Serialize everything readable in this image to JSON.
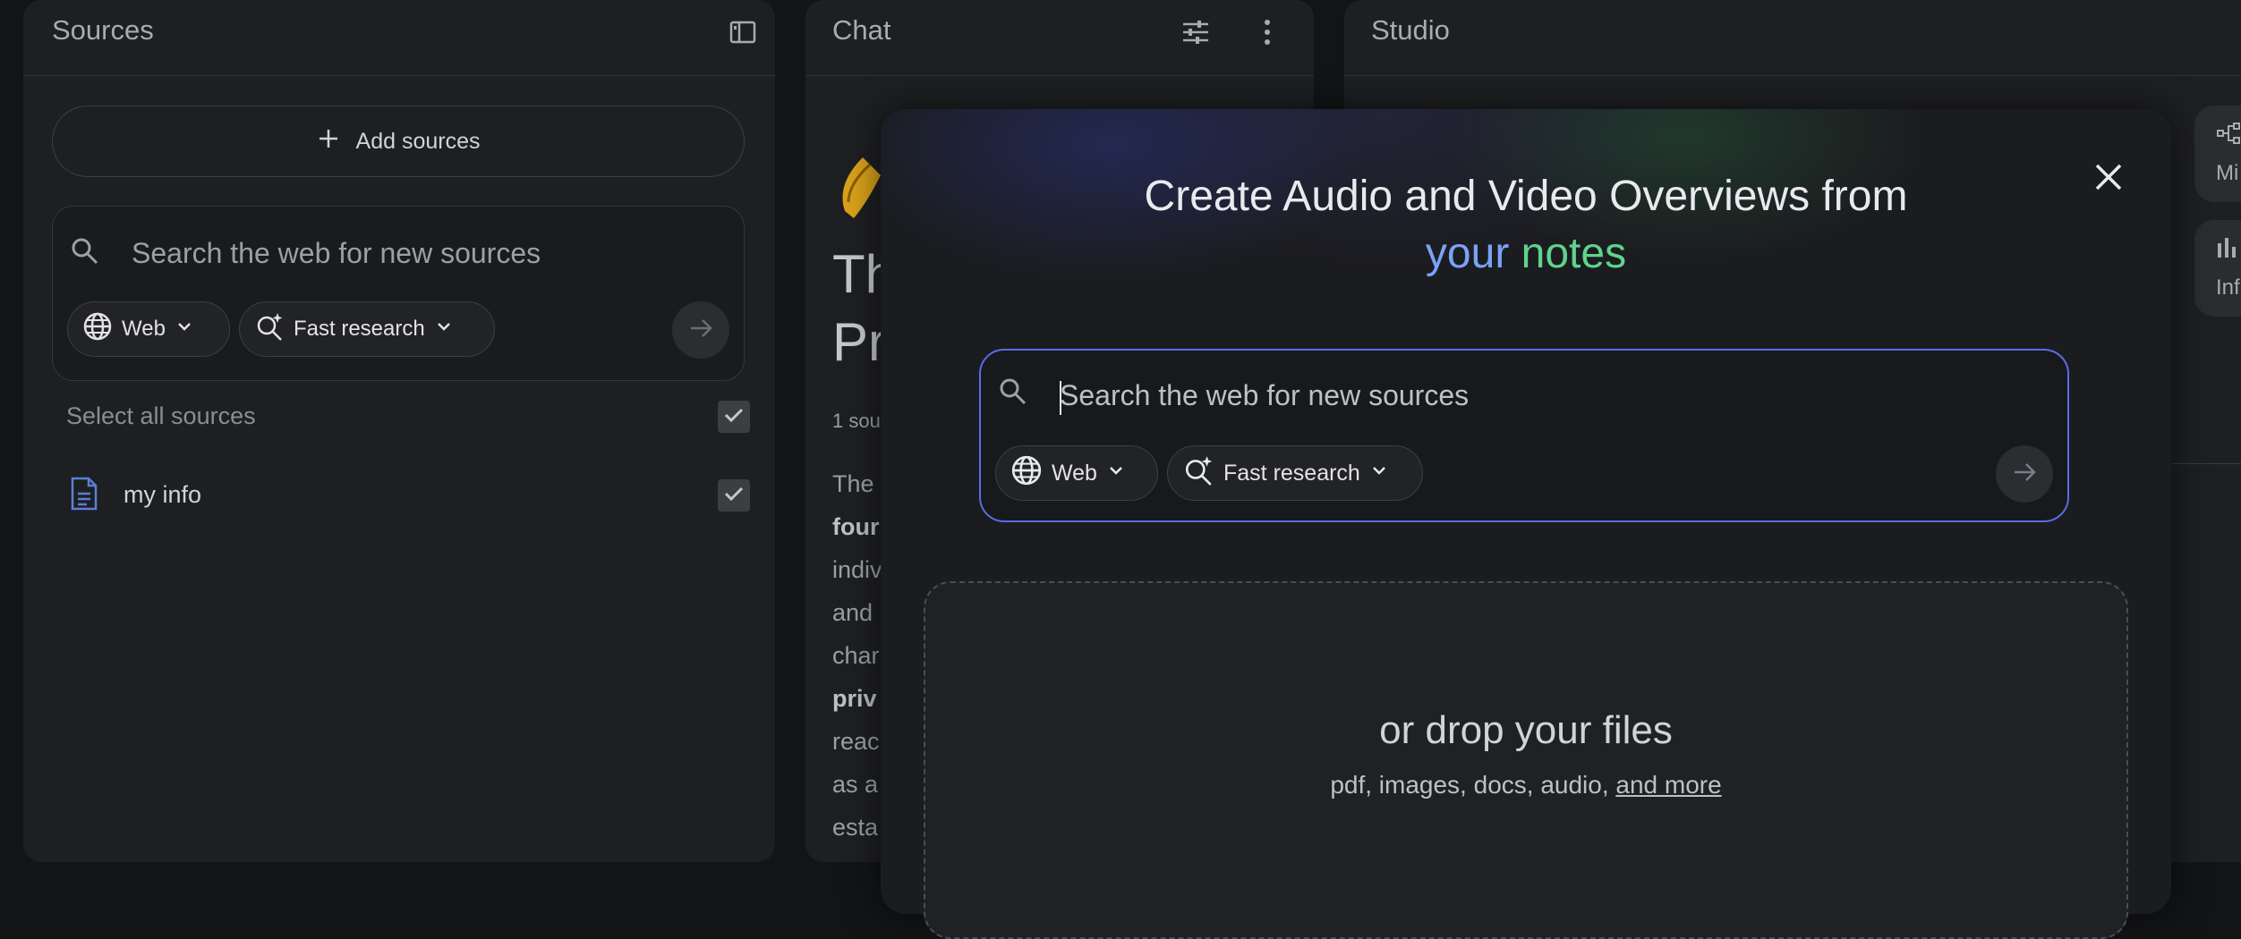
{
  "sources": {
    "title": "Sources",
    "add_sources_label": "Add sources",
    "search_placeholder": "Search the web for new sources",
    "web_chip": "Web",
    "research_chip": "Fast research",
    "select_all_label": "Select all sources",
    "items": [
      {
        "label": "my info",
        "checked": true
      }
    ]
  },
  "chat": {
    "title": "Chat",
    "heading_fragment_1": "Th",
    "heading_fragment_2": "Pr",
    "source_count_fragment": "1 sou",
    "body_lines": [
      "The",
      "four",
      "indiv",
      "and",
      "char",
      "priv",
      "reac",
      "as a",
      "esta"
    ]
  },
  "studio": {
    "title": "Studio",
    "card_labels": [
      "Mi",
      "Inf"
    ]
  },
  "modal": {
    "title_line1": "Create Audio and Video Overviews from",
    "title_word1": "your",
    "title_word2": "notes",
    "search_placeholder": "Search the web for new sources",
    "web_chip": "Web",
    "research_chip": "Fast research",
    "drop_title": "or drop your files",
    "drop_sub_text": "pdf, images, docs, audio, ",
    "drop_sub_link": "and more"
  },
  "colors": {
    "accent_blue": "#7aa2f7",
    "accent_green": "#5fd38c",
    "search_border": "#5b6be8"
  }
}
